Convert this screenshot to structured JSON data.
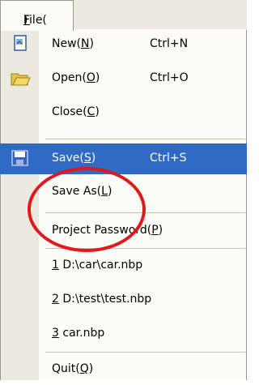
{
  "menu_title": {
    "text": "File(",
    "key": "F",
    "close": ")"
  },
  "items": [
    {
      "id": "new",
      "pre": "New(",
      "key": "N",
      "post": ")",
      "shortcut": "Ctrl+N",
      "icon": "new-document-icon"
    },
    {
      "id": "open",
      "pre": "Open(",
      "key": "O",
      "post": ")",
      "shortcut": "Ctrl+O",
      "icon": "open-folder-icon"
    },
    {
      "id": "close",
      "pre": "Close(",
      "key": "C",
      "post": ")",
      "shortcut": ""
    },
    {
      "id": "save",
      "pre": "Save(",
      "key": "S",
      "post": ")",
      "shortcut": "Ctrl+S",
      "icon": "floppy-disk-icon",
      "highlighted": true
    },
    {
      "id": "save-as",
      "pre": "Save As(",
      "key": "L",
      "post": ")",
      "shortcut": ""
    },
    {
      "id": "password",
      "pre": "Project Password(",
      "key": "P",
      "post": ")",
      "shortcut": ""
    },
    {
      "id": "recent-1",
      "pre": "",
      "key": "1",
      "post": " D:\\car\\car.nbp",
      "shortcut": ""
    },
    {
      "id": "recent-2",
      "pre": "",
      "key": "2",
      "post": " D:\\test\\test.nbp",
      "shortcut": ""
    },
    {
      "id": "recent-3",
      "pre": "",
      "key": "3",
      "post": " car.nbp",
      "shortcut": ""
    },
    {
      "id": "quit",
      "pre": "Quit(",
      "key": "Q",
      "post": ")",
      "shortcut": ""
    }
  ],
  "colors": {
    "highlight": "#316ac5",
    "annotation": "#e0191c",
    "gutter": "#eceae0"
  }
}
